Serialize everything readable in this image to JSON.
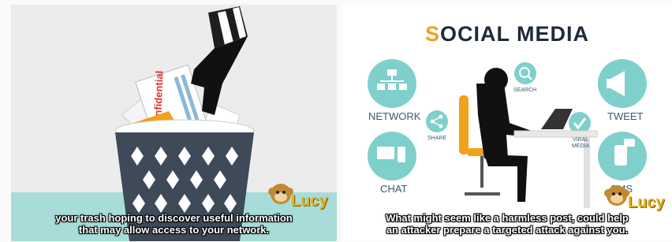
{
  "left_slide": {
    "trash_label": "onfidential",
    "caption_line1": "your trash hoping to discover useful information",
    "caption_line2": "that may allow access to your network.",
    "logo_text": "Lucy"
  },
  "right_slide": {
    "title_first_letter": "S",
    "title_rest": "OCIAL MEDIA",
    "labels": {
      "network": "NETWORK",
      "chat": "CHAT",
      "share": "SHARE",
      "search": "SEARCH",
      "viral_line1": "VIRAL",
      "viral_line2": "MEDIA",
      "tweet": "TWEET",
      "sms": "SMS"
    },
    "caption_line1": "What might seem like a harmless post, could help",
    "caption_line2": "an attacker prepare a targeted attack against you.",
    "logo_text": "Lucy"
  },
  "colors": {
    "teal": "#a8dcd8",
    "icon_circle": "#7fd0cb",
    "bin": "#3e4a58",
    "orange": "#f0a21b",
    "dark_text": "#1f2a3a"
  }
}
